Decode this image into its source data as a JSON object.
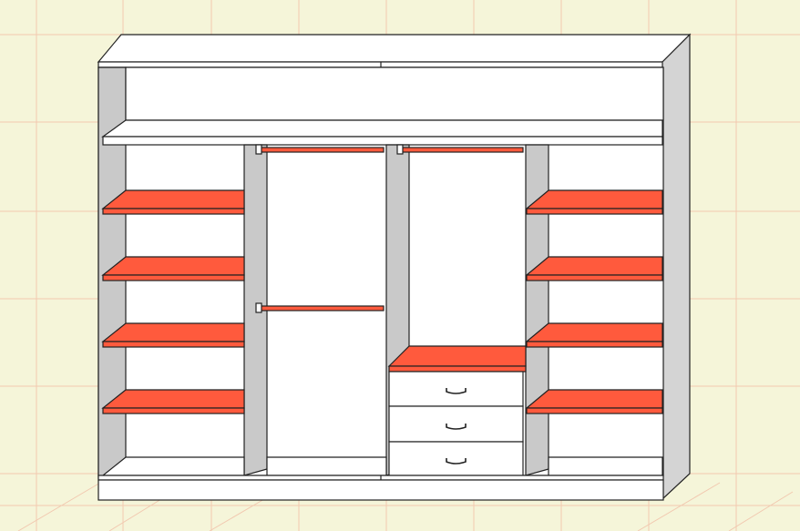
{
  "scene": {
    "subject": "wardrobe-diagram",
    "left_section": {
      "shelf_count": 4
    },
    "right_section": {
      "shelf_count": 4
    },
    "hanging_left": {
      "rail_count": 2
    },
    "hanging_right": {
      "rail_count": 1
    },
    "drawer_unit": {
      "drawer_count": 3
    }
  },
  "colors": {
    "background": "#f5f5d9",
    "grid_line": "#f2c9b0",
    "panel_white": "#ffffff",
    "panel_gray": "#c9c9c9",
    "shelf_accent": "#ff5a3d",
    "outline": "#222222"
  },
  "icons": {
    "rail": "hanging-rail-icon",
    "handle": "drawer-handle-icon"
  }
}
